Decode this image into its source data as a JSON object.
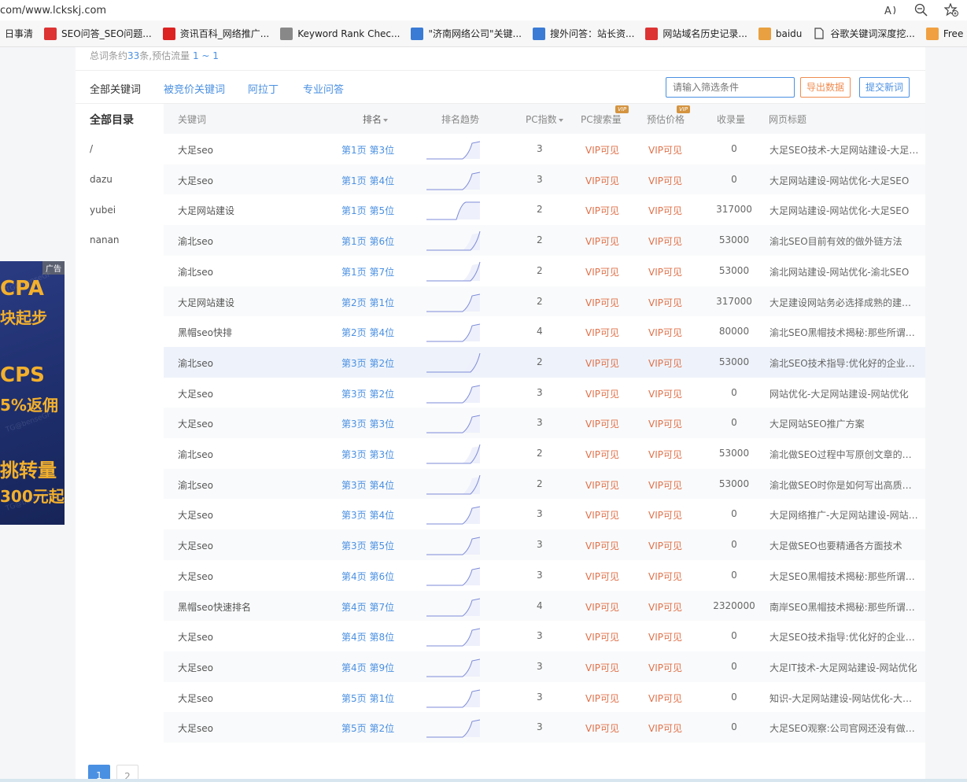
{
  "browser": {
    "url": "com/www.lckskj.com",
    "tools": [
      "read-aloud-icon",
      "zoom-out-icon",
      "favorites-add-icon"
    ]
  },
  "bookmarks": [
    {
      "label": "日事清",
      "icon": "none",
      "color": ""
    },
    {
      "label": "SEO问答_SEO问题...",
      "icon": "seo-wenda-icon",
      "color": "#d33"
    },
    {
      "label": "资讯百科_网络推广...",
      "icon": "zixun-icon",
      "color": "#d22"
    },
    {
      "label": "Keyword Rank Chec...",
      "icon": "keyword-rank-icon",
      "color": "#888"
    },
    {
      "label": "\"济南网络公司\"关键...",
      "icon": "jinan-icon",
      "color": "#3a7bd5"
    },
    {
      "label": "搜外问答：站长资...",
      "icon": "souwai-icon",
      "color": "#3a7bd5"
    },
    {
      "label": "网站域名历史记录...",
      "icon": "domain-history-icon",
      "color": "#d33"
    },
    {
      "label": "baidu",
      "icon": "baidu-icon",
      "color": "#e8a040"
    },
    {
      "label": "谷歌关键词深度挖...",
      "icon": "page-icon",
      "color": "#444"
    },
    {
      "label": "Free SE",
      "icon": "free-se-icon",
      "color": "#f0a040"
    }
  ],
  "summary": {
    "prefix": "总词条约",
    "count": "33",
    "mid": "条,预估流量 ",
    "traffic": "1 ~ 1"
  },
  "tabs": [
    "全部关键词",
    "被竞价关键词",
    "阿拉丁",
    "专业问答"
  ],
  "filter_placeholder": "请输入筛选条件",
  "export_label": "导出数据",
  "submit_label": "提交新词",
  "directory": {
    "title": "全部目录",
    "items": [
      "/",
      "dazu",
      "yubei",
      "nanan"
    ]
  },
  "columns": {
    "keyword": "关键词",
    "rank": "排名",
    "trend": "排名趋势",
    "pc_index": "PC指数",
    "pc_search": "PC搜索量",
    "est_price": "预估价格",
    "indexed": "收录量",
    "page_title": "网页标题",
    "vip_badge": "VIP"
  },
  "rows": [
    {
      "keyword": "大足seo",
      "rank": "第1页 第3位",
      "pc": "3",
      "search": "VIP可见",
      "price": "VIP可见",
      "indexed": "0",
      "title": "大足SEO技术-大足网站建设-大足网站优化"
    },
    {
      "keyword": "大足seo",
      "rank": "第1页 第4位",
      "pc": "3",
      "search": "VIP可见",
      "price": "VIP可见",
      "indexed": "0",
      "title": "大足网站建设-网站优化-大足SEO"
    },
    {
      "keyword": "大足网站建设",
      "rank": "第1页 第5位",
      "pc": "2",
      "search": "VIP可见",
      "price": "VIP可见",
      "indexed": "317000",
      "title": "大足网站建设-网站优化-大足SEO"
    },
    {
      "keyword": "渝北seo",
      "rank": "第1页 第6位",
      "pc": "2",
      "search": "VIP可见",
      "price": "VIP可见",
      "indexed": "53000",
      "title": "渝北SEO目前有效的做外链方法"
    },
    {
      "keyword": "渝北seo",
      "rank": "第1页 第7位",
      "pc": "2",
      "search": "VIP可见",
      "price": "VIP可见",
      "indexed": "53000",
      "title": "渝北网站建设-网站优化-渝北SEO"
    },
    {
      "keyword": "大足网站建设",
      "rank": "第2页 第1位",
      "pc": "2",
      "search": "VIP可见",
      "price": "VIP可见",
      "indexed": "317000",
      "title": "大足建设网站务必选择成熟的建站公司"
    },
    {
      "keyword": "黑帽seo快排",
      "rank": "第2页 第4位",
      "pc": "4",
      "search": "VIP可见",
      "price": "VIP可见",
      "indexed": "80000",
      "title": "渝北SEO黑帽技术揭秘:那些所谓的快排"
    },
    {
      "keyword": "渝北seo",
      "rank": "第3页 第2位",
      "pc": "2",
      "search": "VIP可见",
      "price": "VIP可见",
      "indexed": "53000",
      "title": "渝北SEO技术指导:优化好的企业网站"
    },
    {
      "keyword": "大足seo",
      "rank": "第3页 第2位",
      "pc": "3",
      "search": "VIP可见",
      "price": "VIP可见",
      "indexed": "0",
      "title": "网站优化-大足网站建设-网站优化"
    },
    {
      "keyword": "大足seo",
      "rank": "第3页 第3位",
      "pc": "3",
      "search": "VIP可见",
      "price": "VIP可见",
      "indexed": "0",
      "title": "大足网站SEO推广方案"
    },
    {
      "keyword": "渝北seo",
      "rank": "第3页 第3位",
      "pc": "2",
      "search": "VIP可见",
      "price": "VIP可见",
      "indexed": "53000",
      "title": "渝北做SEO过程中写原创文章的技巧"
    },
    {
      "keyword": "渝北seo",
      "rank": "第3页 第4位",
      "pc": "2",
      "search": "VIP可见",
      "price": "VIP可见",
      "indexed": "53000",
      "title": "渝北做SEO时你是如何写出高质量文章"
    },
    {
      "keyword": "大足seo",
      "rank": "第3页 第4位",
      "pc": "3",
      "search": "VIP可见",
      "price": "VIP可见",
      "indexed": "0",
      "title": "大足网络推广-大足网站建设-网站优化"
    },
    {
      "keyword": "大足seo",
      "rank": "第3页 第5位",
      "pc": "3",
      "search": "VIP可见",
      "price": "VIP可见",
      "indexed": "0",
      "title": "大足做SEO也要精通各方面技术"
    },
    {
      "keyword": "大足seo",
      "rank": "第4页 第6位",
      "pc": "3",
      "search": "VIP可见",
      "price": "VIP可见",
      "indexed": "0",
      "title": "大足SEO黑帽技术揭秘:那些所谓的快排"
    },
    {
      "keyword": "黑帽seo快速排名",
      "rank": "第4页 第7位",
      "pc": "4",
      "search": "VIP可见",
      "price": "VIP可见",
      "indexed": "2320000",
      "title": "南岸SEO黑帽技术揭秘:那些所谓的快排"
    },
    {
      "keyword": "大足seo",
      "rank": "第4页 第8位",
      "pc": "3",
      "search": "VIP可见",
      "price": "VIP可见",
      "indexed": "0",
      "title": "大足SEO技术指导:优化好的企业网站"
    },
    {
      "keyword": "大足seo",
      "rank": "第4页 第9位",
      "pc": "3",
      "search": "VIP可见",
      "price": "VIP可见",
      "indexed": "0",
      "title": "大足IT技术-大足网站建设-网站优化"
    },
    {
      "keyword": "大足seo",
      "rank": "第5页 第1位",
      "pc": "3",
      "search": "VIP可见",
      "price": "VIP可见",
      "indexed": "0",
      "title": "知识-大足网站建设-网站优化-大足SEO"
    },
    {
      "keyword": "大足seo",
      "rank": "第5页 第2位",
      "pc": "3",
      "search": "VIP可见",
      "price": "VIP可见",
      "indexed": "0",
      "title": "大足SEO观察:公司官网还没有做SEO"
    }
  ],
  "pager": [
    "1",
    "2"
  ],
  "ad": {
    "tag": "广告",
    "lines": [
      "CPA",
      "块起步",
      "CPS",
      "5%返佣",
      "挑转量",
      "300元起"
    ],
    "watermark": "TG@benseGF"
  },
  "colors": {
    "accent": "#4a90e2",
    "vip": "#e0714a",
    "export": "#f08c50",
    "ad_bg": "#1d2d6a",
    "ad_text": "#f3b02c"
  }
}
